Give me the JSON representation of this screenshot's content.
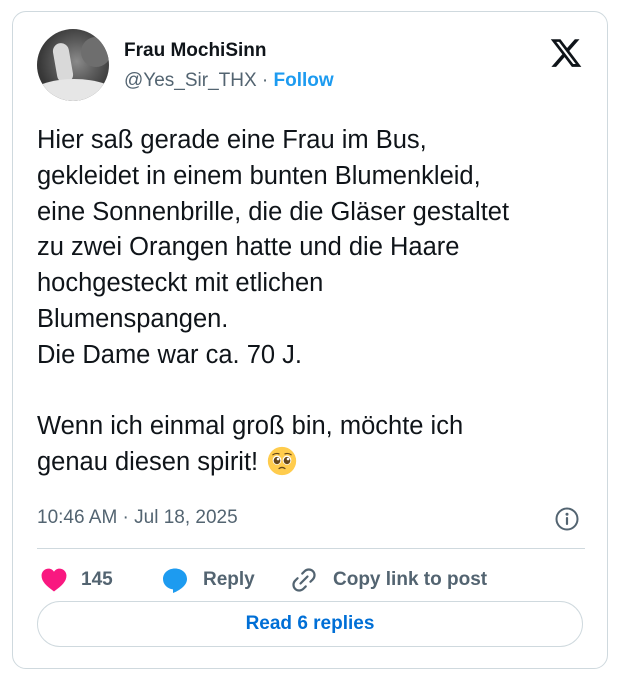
{
  "author": {
    "display_name": "Frau MochiSinn",
    "handle": "@Yes_Sir_THX",
    "separator": " · ",
    "follow_label": "Follow"
  },
  "tweet": {
    "text": "Hier saß gerade eine Frau im Bus,\ngekleidet in einem bunten Blumenkleid,\neine Sonnenbrille, die die Gläser gestaltet\nzu zwei Orangen hatte und die Haare\nhochgesteckt mit etlichen\nBlumenspangen.\nDie Dame war ca. 70 J.\n\nWenn ich einmal groß bin, möchte ich\ngenau diesen spirit! ",
    "emoji": "pleading-face-emoji",
    "timestamp": "10:46 AM · Jul 18, 2025"
  },
  "actions": {
    "like_count": "145",
    "reply_label": "Reply",
    "copy_label": "Copy link to post",
    "read_replies_label": "Read 6 replies"
  },
  "colors": {
    "like": "#f91880",
    "reply": "#1d9bf0",
    "link_blue": "#006fd6",
    "muted": "#536471",
    "border": "#cfd9de"
  }
}
